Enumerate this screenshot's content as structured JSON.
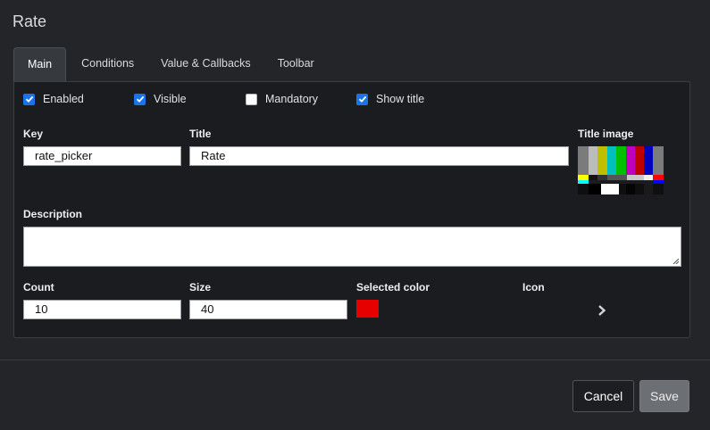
{
  "dialog": {
    "title": "Rate"
  },
  "tabs": [
    {
      "label": "Main",
      "active": true
    },
    {
      "label": "Conditions",
      "active": false
    },
    {
      "label": "Value & Callbacks",
      "active": false
    },
    {
      "label": "Toolbar",
      "active": false
    }
  ],
  "checkboxes": {
    "enabled": {
      "label": "Enabled",
      "checked": true
    },
    "visible": {
      "label": "Visible",
      "checked": true
    },
    "mandatory": {
      "label": "Mandatory",
      "checked": false
    },
    "show_title": {
      "label": "Show title",
      "checked": true
    }
  },
  "fields": {
    "key": {
      "label": "Key",
      "value": "rate_picker"
    },
    "title": {
      "label": "Title",
      "value": "Rate"
    },
    "title_image": {
      "label": "Title image"
    },
    "description": {
      "label": "Description",
      "value": ""
    },
    "count": {
      "label": "Count",
      "value": "10"
    },
    "size": {
      "label": "Size",
      "value": "40"
    },
    "selected_color": {
      "label": "Selected color",
      "value": "#e60000"
    },
    "icon": {
      "label": "Icon",
      "icon_name": "chevron-right-icon"
    }
  },
  "footer": {
    "cancel_label": "Cancel",
    "save_label": "Save"
  },
  "colors": {
    "checkbox_accent": "#1a73e8",
    "panel_bg": "#1b1c1f",
    "page_bg": "#242528"
  }
}
